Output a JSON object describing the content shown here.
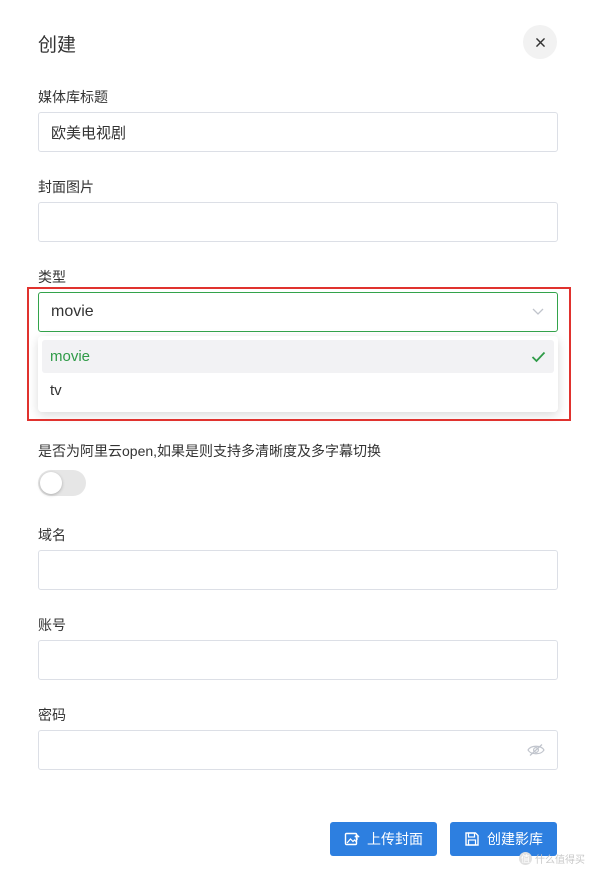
{
  "dialog": {
    "title": "创建"
  },
  "fields": {
    "library_title": {
      "label": "媒体库标题",
      "value": "欧美电视剧"
    },
    "cover_image": {
      "label": "封面图片",
      "value": ""
    },
    "type": {
      "label": "类型",
      "selected": "movie",
      "options": [
        "movie",
        "tv"
      ]
    },
    "aliyun_open": {
      "label": "是否为阿里云open,如果是则支持多清晰度及多字幕切换",
      "enabled": false
    },
    "domain": {
      "label": "域名",
      "value": ""
    },
    "account": {
      "label": "账号",
      "value": ""
    },
    "password": {
      "label": "密码",
      "value": ""
    }
  },
  "buttons": {
    "upload_cover": "上传封面",
    "create_library": "创建影库"
  },
  "icons": {
    "close": "close-icon",
    "chevron": "chevron-down-icon",
    "check": "check-icon",
    "eye": "eye-hidden-icon",
    "image_upload": "image-upload-icon",
    "save": "save-icon"
  },
  "colors": {
    "accent_green": "#2f9b47",
    "primary_blue": "#2d7fe0",
    "highlight_red": "#e0322e"
  },
  "watermark": {
    "text": "什么值得买"
  }
}
